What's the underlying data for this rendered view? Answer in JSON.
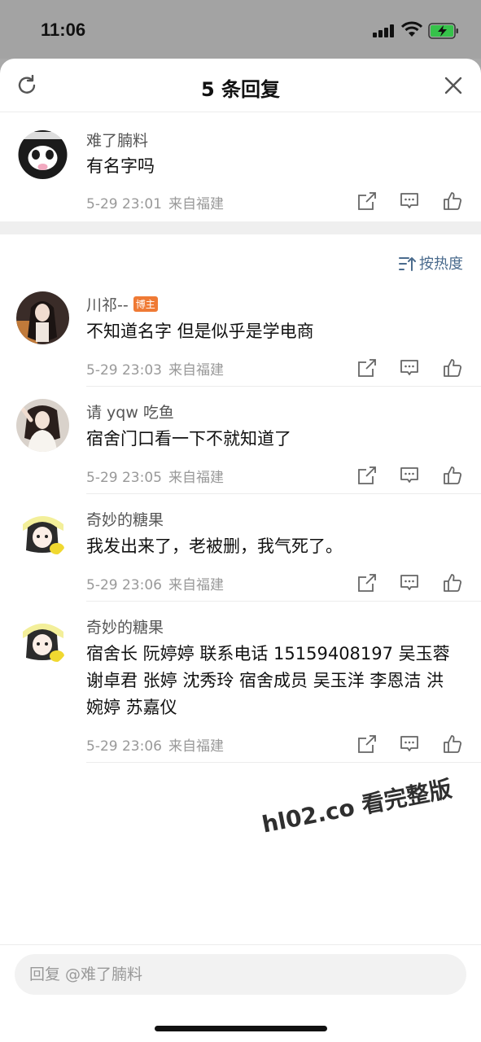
{
  "status_bar": {
    "time": "11:06"
  },
  "sheet": {
    "title": "5 条回复"
  },
  "parent_comment": {
    "username": "难了腩料",
    "text": "有名字吗",
    "date": "5-29 23:01",
    "location": "来自福建"
  },
  "sort_label": "按热度",
  "replies": [
    {
      "username": "川祁--",
      "badge": "博主",
      "text": "不知道名字 但是似乎是学电商",
      "date": "5-29 23:03",
      "location": "来自福建"
    },
    {
      "username": "请 yqw 吃鱼",
      "text": "宿舍门口看一下不就知道了",
      "date": "5-29 23:05",
      "location": "来自福建"
    },
    {
      "username": "奇妙的糖果",
      "text": "我发出来了，老被删，我气死了。",
      "date": "5-29 23:06",
      "location": "来自福建"
    },
    {
      "username": "奇妙的糖果",
      "text": "宿舍长 阮婷婷 联系电话 15159408197 吴玉蓉 谢卓君 张婷 沈秀玲 宿舍成员 吴玉洋 李恩洁 洪婉婷 苏嘉仪",
      "date": "5-29 23:06",
      "location": "来自福建"
    }
  ],
  "watermark": "hl02.co 看完整版",
  "reply_box": {
    "placeholder": "回复 @难了腩料"
  },
  "colors": {
    "link": "#4a6b8d",
    "badge": "#ef7a35",
    "meta": "#999999",
    "battery": "#36c24a"
  }
}
